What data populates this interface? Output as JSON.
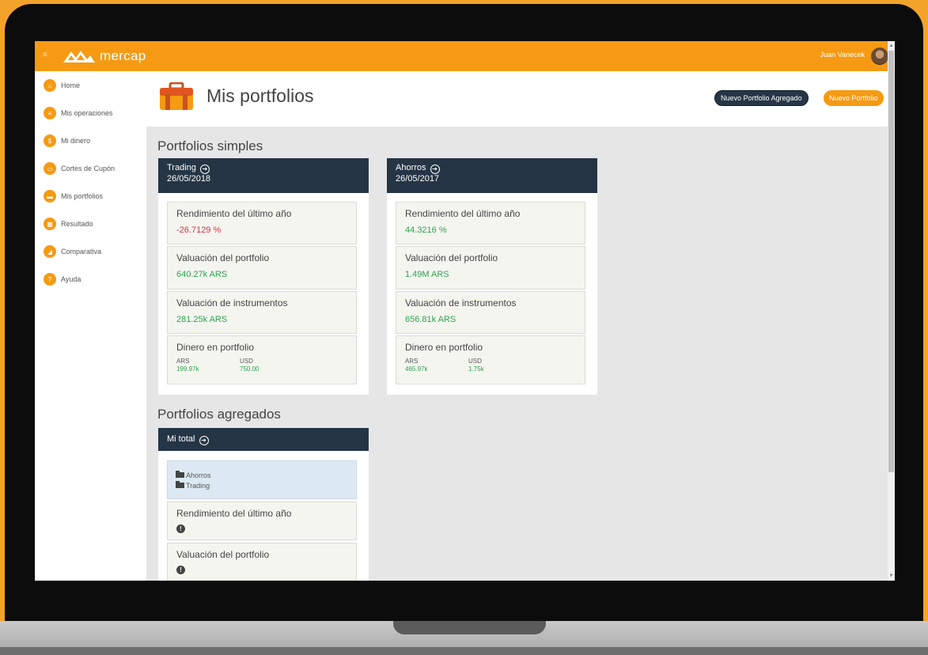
{
  "topbar": {
    "brand": "mercap",
    "user": "Juan Vanecek"
  },
  "sidebar": {
    "items": [
      {
        "label": "Home"
      },
      {
        "label": "Mis operaciones"
      },
      {
        "label": "Mi dinero"
      },
      {
        "label": "Cortes de Cupón"
      },
      {
        "label": "Mis portfolios"
      },
      {
        "label": "Resultado"
      },
      {
        "label": "Comparativa"
      },
      {
        "label": "Ayuda"
      }
    ]
  },
  "header": {
    "title": "Mis portfolios",
    "btn_aggregate": "Nuevo Portfolio Agregado",
    "btn_new": "Nuevo Portfolio"
  },
  "simple": {
    "title": "Portfolios simples",
    "cards": [
      {
        "name": "Trading",
        "date": "26/05/2018",
        "return_label": "Rendimiento del último año",
        "return_value": "-26.7129 %",
        "valuation_label": "Valuación del portfolio",
        "valuation_value": "640.27k ARS",
        "instruments_label": "Valuación de instrumentos",
        "instruments_value": "281.25k ARS",
        "cash_label": "Dinero en portfolio",
        "cash": [
          {
            "currency": "ARS",
            "amount": "199.97k"
          },
          {
            "currency": "USD",
            "amount": "750.00"
          }
        ]
      },
      {
        "name": "Ahorros",
        "date": "26/05/2017",
        "return_label": "Rendimiento del último año",
        "return_value": "44.3216 %",
        "valuation_label": "Valuación del portfolio",
        "valuation_value": "1.49M ARS",
        "instruments_label": "Valuación de instrumentos",
        "instruments_value": "656.81k ARS",
        "cash_label": "Dinero en portfolio",
        "cash": [
          {
            "currency": "ARS",
            "amount": "465.97k"
          },
          {
            "currency": "USD",
            "amount": "1.75k"
          }
        ]
      }
    ]
  },
  "aggregated": {
    "title": "Portfolios agregados",
    "card": {
      "name": "Mi total",
      "members": [
        "Ahorros",
        "Trading"
      ],
      "return_label": "Rendimiento del último año",
      "valuation_label": "Valuación del portfolio",
      "warn_symbol": "!"
    }
  },
  "colors": {
    "orange": "#f59a12",
    "navy": "#253545",
    "positive": "#2ea44f",
    "negative": "#d2354a"
  }
}
